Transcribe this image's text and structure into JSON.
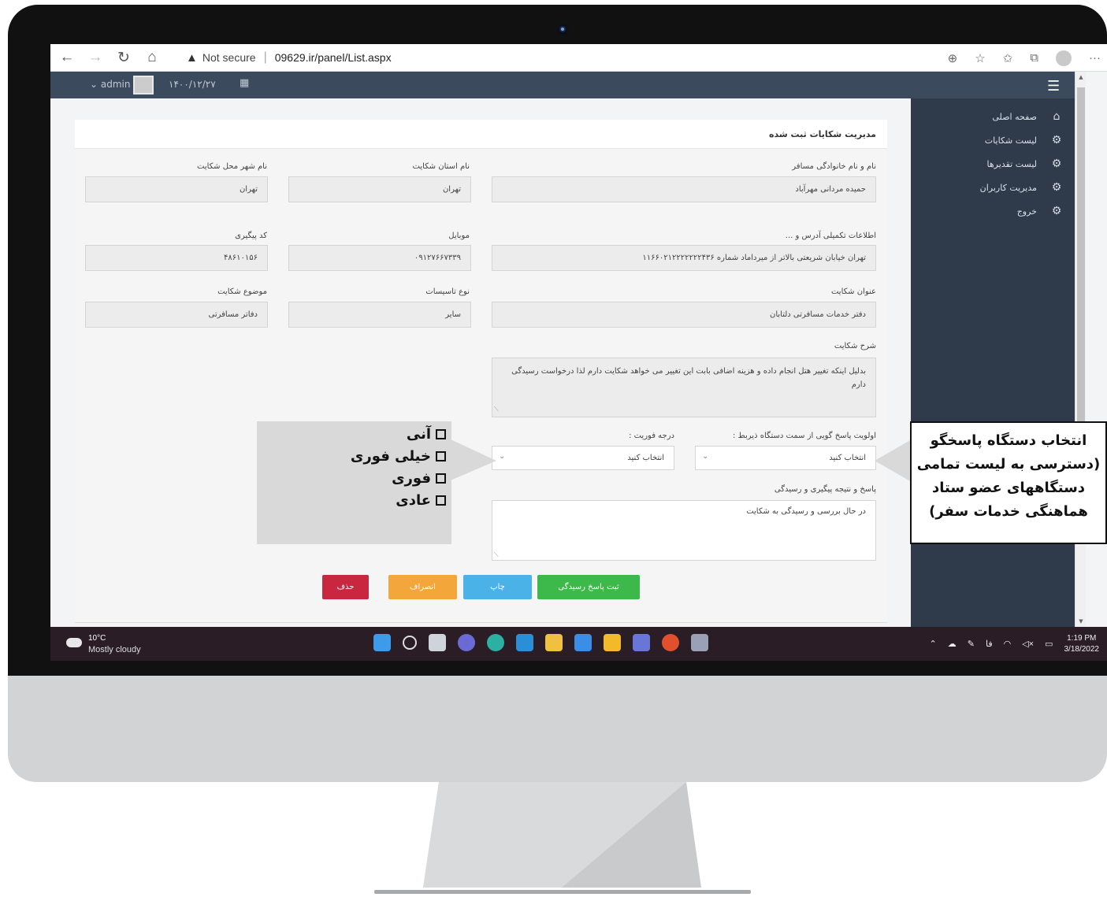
{
  "browser": {
    "security_label": "Not secure",
    "url": "09629.ir/panel/List.aspx"
  },
  "app_bar": {
    "user": "admin",
    "date": "۱۴۰۰/۱۲/۲۷"
  },
  "sidebar": {
    "items": [
      {
        "label": "صفحه اصلی",
        "icon": "home-icon"
      },
      {
        "label": "لیست شکایات",
        "icon": "gear-icon"
      },
      {
        "label": "لیست تقدیرها",
        "icon": "gear-icon"
      },
      {
        "label": "مدیریت کاربران",
        "icon": "gear-icon"
      },
      {
        "label": "خروج",
        "icon": "gear-icon"
      }
    ]
  },
  "form": {
    "title": "مدیریت شکایات ثبت شده",
    "passenger_name": {
      "label": "نام و نام خانوادگی مسافر",
      "value": "حمیده مردانی مهرآباد"
    },
    "province": {
      "label": "نام استان شکایت",
      "value": "تهران"
    },
    "city": {
      "label": "نام شهر محل شکایت",
      "value": "تهران"
    },
    "address": {
      "label": "اطلاعات تکمیلی آدرس و ...",
      "value": "تهران خیابان شریعتی بالاتر از میرداماد شماره ۱۱۶۶۰۲۱۲۲۲۲۲۲۲۴۳۶"
    },
    "mobile": {
      "label": "موبایل",
      "value": "۰۹۱۲۷۶۶۷۳۳۹"
    },
    "tracking_code": {
      "label": "کد پیگیری",
      "value": "۴۸۶۱۰۱۵۶"
    },
    "complaint_title": {
      "label": "عنوان شکایت",
      "value": "دفتر خدمات مسافرتی دلتابان"
    },
    "facility_type": {
      "label": "نوع تاسیسات",
      "value": "سایر"
    },
    "complaint_subject": {
      "label": "موضوع شکایت",
      "value": "دفاتر مسافرتی"
    },
    "description": {
      "label": "شرح شکایت",
      "value": "بدلیل اینکه تغییر هتل انجام داده و هزینه اضافی بابت این تغییر می خواهد شکایت دارم لذا درخواست رسیدگی دارم"
    },
    "priority_body": {
      "label": "اولویت پاسخ گویی از سمت دستگاه ذیربط :",
      "value": "انتخاب کنید"
    },
    "urgency": {
      "label": "درجه فوریت :",
      "value": "انتخاب کنید"
    },
    "response": {
      "label": "پاسخ و نتیجه پیگیری و رسیدگی",
      "value": "در حال بررسی و رسیدگی به شکایت"
    },
    "buttons": {
      "submit": "ثبت پاسخ رسیدگی",
      "print": "چاپ",
      "cancel": "انصراف",
      "delete": "حذف"
    }
  },
  "taskbar": {
    "temperature": "10°C",
    "weather": "Mostly cloudy",
    "lang": "فا",
    "time": "1:19 PM",
    "date": "3/18/2022"
  },
  "annotations": {
    "urgency_options": [
      "آنی",
      "خیلی فوری",
      "فوری",
      "عادی"
    ],
    "responder_note": [
      "انتخاب دستگاه پاسخگو",
      "(دسترسی به لیست تمامی",
      "دستگاههای عضو ستاد",
      "هماهنگی خدمات سفر)"
    ]
  },
  "colors": {
    "sidebar": "#2f3a4a",
    "topbar": "#3c4a5e",
    "btn_green": "#3cb94a",
    "btn_blue": "#4ab2e6",
    "btn_orange": "#f3a73b",
    "btn_red": "#c9273f"
  }
}
